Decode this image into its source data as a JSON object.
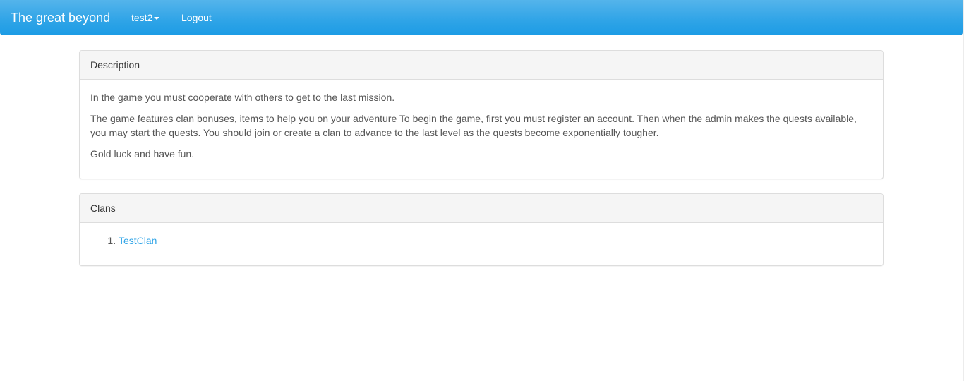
{
  "navbar": {
    "brand": "The great beyond",
    "user_menu_label": "test2",
    "logout_label": "Logout",
    "color": "#2fa4e7"
  },
  "description_panel": {
    "heading": "Description",
    "paragraphs": [
      "In the game you must cooperate with others to get to the last mission.",
      "The game features clan bonuses, items to help you on your adventure To begin the game, first you must register an account. Then when the admin makes the quests available, you may start the quests. You should join or create a clan to advance to the last level as the quests become exponentially tougher.",
      "Gold luck and have fun."
    ]
  },
  "clans_panel": {
    "heading": "Clans",
    "items": [
      {
        "label": "TestClan"
      }
    ],
    "link_color": "#2fa4e7"
  },
  "icons": {
    "user_menu": "caret-down-icon"
  }
}
